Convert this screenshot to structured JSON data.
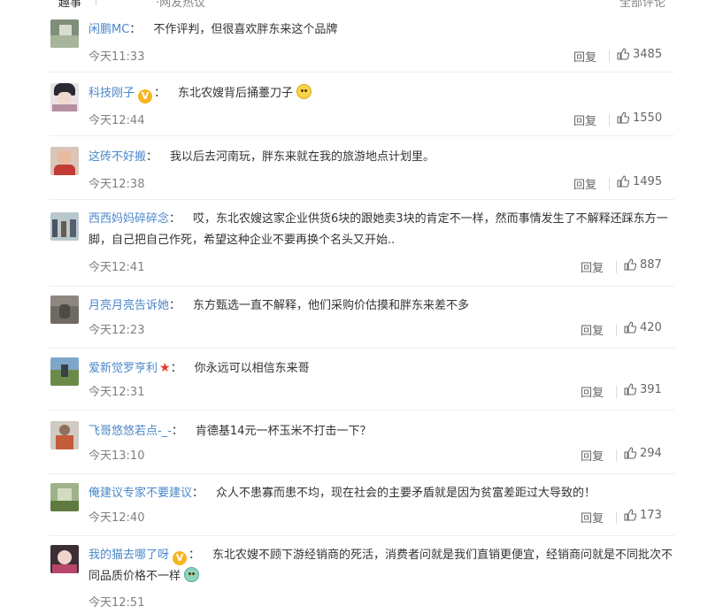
{
  "header": {
    "user_fragment": "趣事",
    "subtitle_fragment": "·网友热议",
    "count_fragment": "全部评论"
  },
  "comments": [
    {
      "username": "闲鹏MC",
      "content": "不作评判，但很喜欢胖东来这个品牌",
      "time": "今天11:33",
      "reply_label": "回复",
      "likes": "3485"
    },
    {
      "username": "科技刚子",
      "badge": "V",
      "content": "东北农嫂背后捅薹刀子",
      "emoji": "cat-face",
      "time": "今天12:44",
      "reply_label": "回复",
      "likes": "1550"
    },
    {
      "username": "这砖不好搬",
      "content": "我以后去河南玩，胖东来就在我的旅游地点计划里。",
      "time": "今天12:38",
      "reply_label": "回复",
      "likes": "1495"
    },
    {
      "username": "西西妈妈碎碎念",
      "content": "哎，东北农嫂这家企业供货6块的跟她卖3块的肯定不一样，然而事情发生了不解释还踩东方一脚，自己把自己作死，希望这种企业不要再换个名头又开始..",
      "time": "今天12:41",
      "reply_label": "回复",
      "likes": "887"
    },
    {
      "username": "月亮月亮告诉她",
      "content": "东方甄选一直不解释，他们采购价估摸和胖东来差不多",
      "time": "今天12:23",
      "reply_label": "回复",
      "likes": "420"
    },
    {
      "username": "爱新觉罗亨利",
      "star": "★",
      "content": "你永远可以相信东来哥",
      "time": "今天12:31",
      "reply_label": "回复",
      "likes": "391"
    },
    {
      "username": "飞哥悠悠若点-_-",
      "content": "肯德基14元一杯玉米不打击一下？",
      "time": "今天13:10",
      "reply_label": "回复",
      "likes": "294"
    },
    {
      "username": "俺建议专家不要建议",
      "content": "众人不患寡而患不均，现在社会的主要矛盾就是因为贫富差距过大导致的！",
      "time": "今天12:40",
      "reply_label": "回复",
      "likes": "173"
    },
    {
      "username": "我的猫去哪了呀",
      "badge": "V",
      "content": "东北农嫂不顾下游经销商的死活，消费者问就是我们直销更便宜，经销商问就是不同批次不同品质价格不一样",
      "emoji": "crying-face",
      "time": "今天12:51",
      "reply_label": "回复",
      "likes": ""
    }
  ],
  "colors": {
    "username": "#4a87c9",
    "text": "#333333",
    "meta": "#808080"
  }
}
